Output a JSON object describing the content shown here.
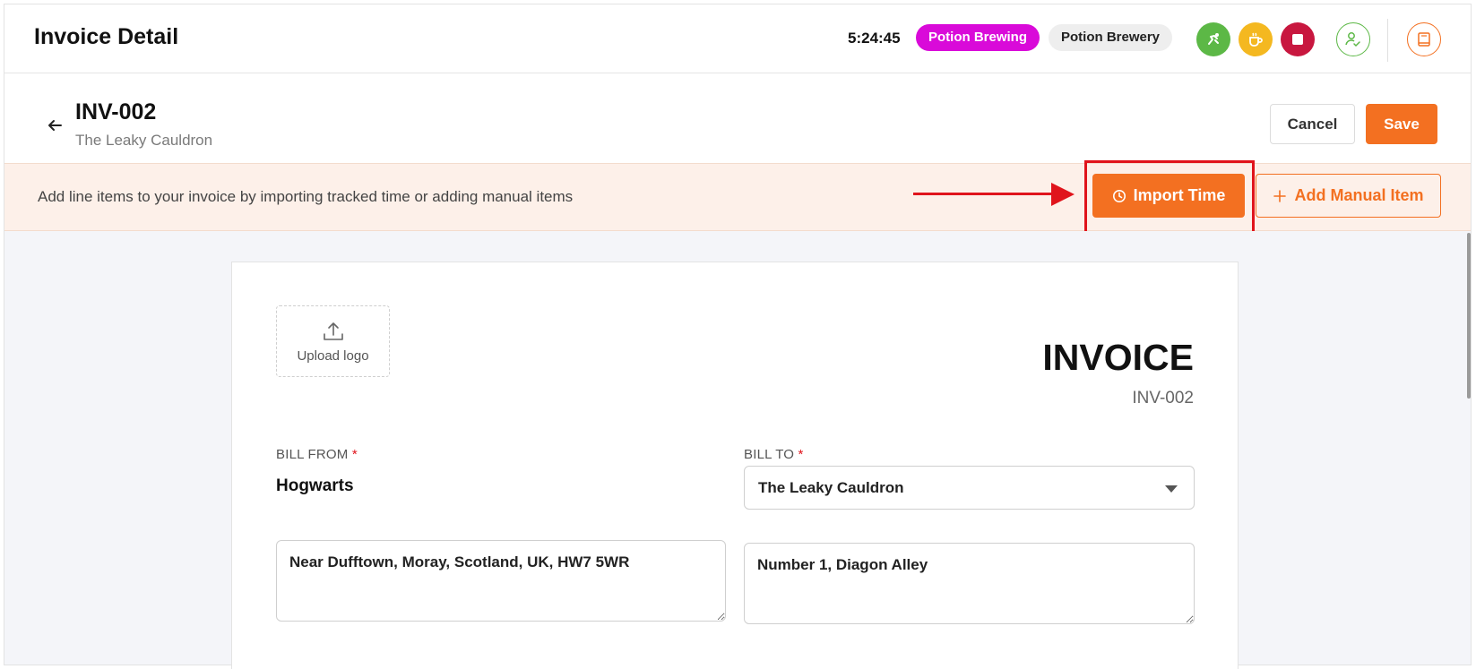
{
  "header": {
    "title": "Invoice Detail",
    "timer": "5:24:45",
    "project_pill": "Potion Brewing",
    "client_pill": "Potion Brewery",
    "colors": {
      "project": "#d90ad9",
      "accent": "#f37021",
      "green": "#5cb846",
      "yellow": "#f4b820",
      "red": "#c8173f"
    }
  },
  "invoice_header": {
    "id": "INV-002",
    "client": "The Leaky Cauldron",
    "cancel_label": "Cancel",
    "save_label": "Save"
  },
  "banner": {
    "text": "Add line items to your invoice by importing tracked time or adding manual items",
    "import_label": "Import Time",
    "manual_label": "Add Manual Item"
  },
  "invoice": {
    "upload_label": "Upload logo",
    "heading": "INVOICE",
    "number": "INV-002",
    "bill_from_label": "BILL FROM",
    "bill_to_label": "BILL TO",
    "required_mark": "*",
    "from_name": "Hogwarts",
    "from_address": "Near Dufftown, Moray, Scotland, UK, HW7 5WR",
    "to_selected": "The Leaky Cauldron",
    "to_address": "Number 1, Diagon Alley"
  }
}
